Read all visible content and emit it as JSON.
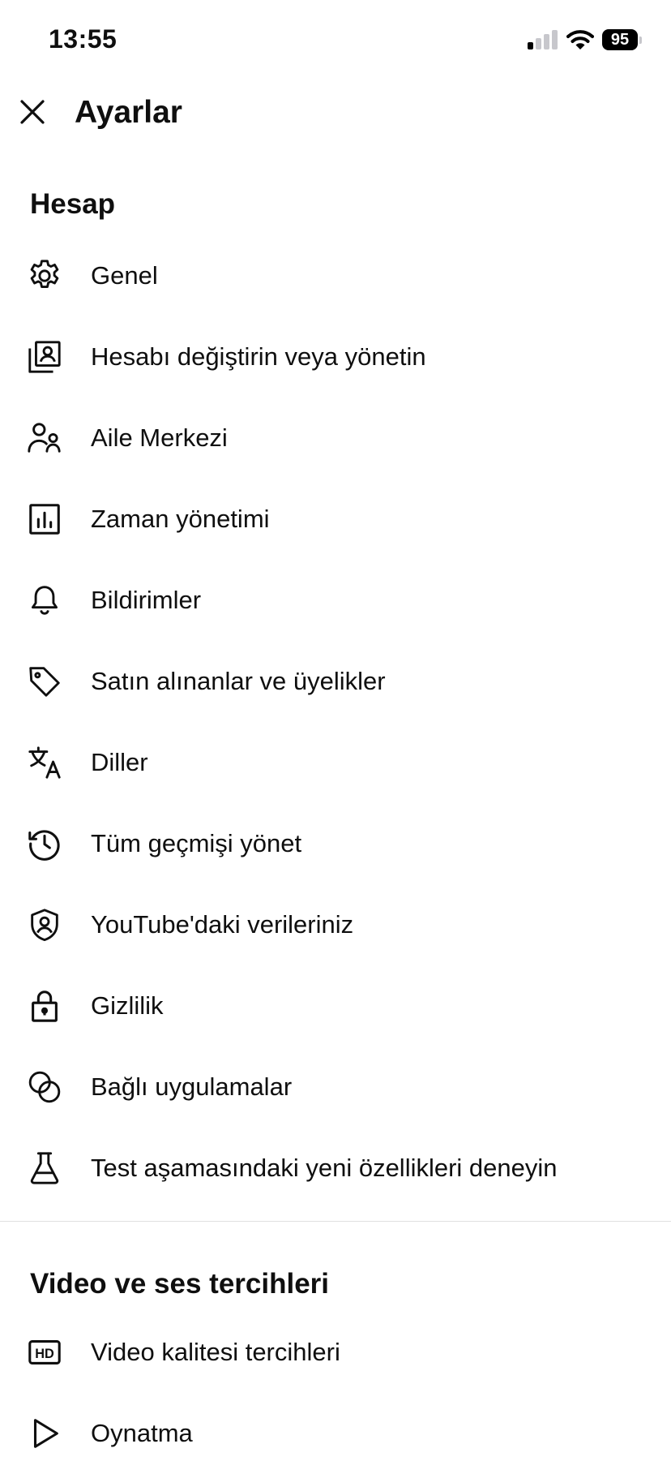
{
  "status_bar": {
    "time": "13:55",
    "battery": "95"
  },
  "header": {
    "title": "Ayarlar"
  },
  "sections": {
    "account": {
      "title": "Hesap",
      "items": [
        {
          "label": "Genel",
          "icon": "gear-icon"
        },
        {
          "label": "Hesabı değiştirin veya yönetin",
          "icon": "switch-account-icon"
        },
        {
          "label": "Aile Merkezi",
          "icon": "family-icon"
        },
        {
          "label": "Zaman yönetimi",
          "icon": "bar-chart-icon"
        },
        {
          "label": "Bildirimler",
          "icon": "bell-icon"
        },
        {
          "label": "Satın alınanlar ve üyelikler",
          "icon": "tag-icon"
        },
        {
          "label": "Diller",
          "icon": "translate-icon"
        },
        {
          "label": "Tüm geçmişi yönet",
          "icon": "history-icon"
        },
        {
          "label": "YouTube'daki verileriniz",
          "icon": "shield-user-icon"
        },
        {
          "label": "Gizlilik",
          "icon": "lock-icon"
        },
        {
          "label": "Bağlı uygulamalar",
          "icon": "linked-circles-icon"
        },
        {
          "label": "Test aşamasındaki yeni özellikleri deneyin",
          "icon": "flask-icon"
        }
      ]
    },
    "video_audio": {
      "title": "Video ve ses tercihleri",
      "items": [
        {
          "label": "Video kalitesi tercihleri",
          "icon": "hd-icon"
        },
        {
          "label": "Oynatma",
          "icon": "play-icon"
        }
      ]
    }
  }
}
